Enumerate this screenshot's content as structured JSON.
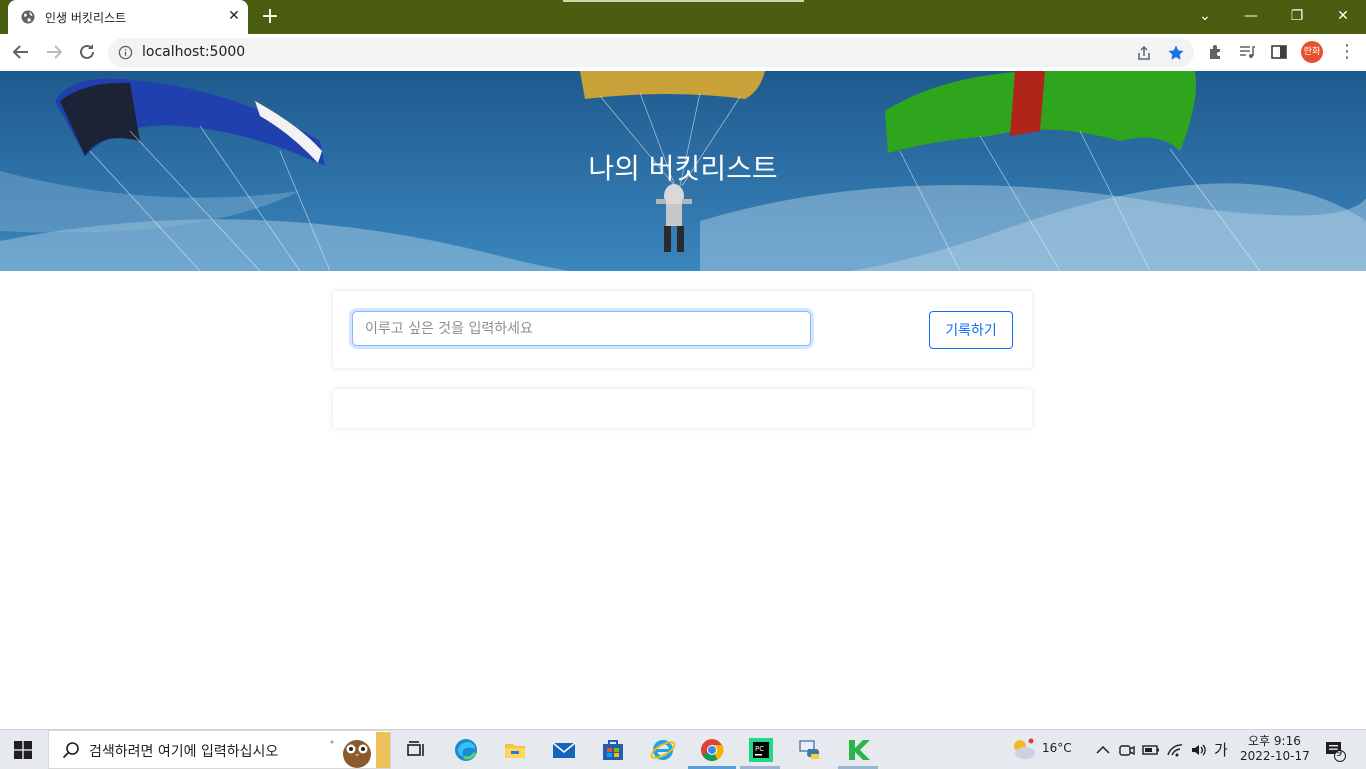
{
  "browser": {
    "tab_title": "인생 버킷리스트",
    "tab_close": "✕",
    "new_tab": "+",
    "url": "localhost:5000",
    "profile_initial": "란화",
    "window_controls": {
      "minimize": "—",
      "restore": "❐",
      "close": "✕",
      "tab_search": "⌄"
    }
  },
  "page": {
    "hero_title": "나의 버킷리스트",
    "input_placeholder": "이루고 싶은 것을 입력하세요",
    "save_button": "기록하기",
    "accent_color": "#0d6efd"
  },
  "taskbar": {
    "search_placeholder": "검색하려면 여기에 입력하십시오",
    "apps": [
      "task-view-icon",
      "edge-icon",
      "file-explorer-icon",
      "mail-icon",
      "store-icon",
      "internet-explorer-icon",
      "chrome-icon",
      "pycharm-icon",
      "python-icon",
      "app-k-icon"
    ],
    "weather": "16°C",
    "ime": "가",
    "time": "오후 9:16",
    "date": "2022-10-17",
    "notifications": "9"
  }
}
